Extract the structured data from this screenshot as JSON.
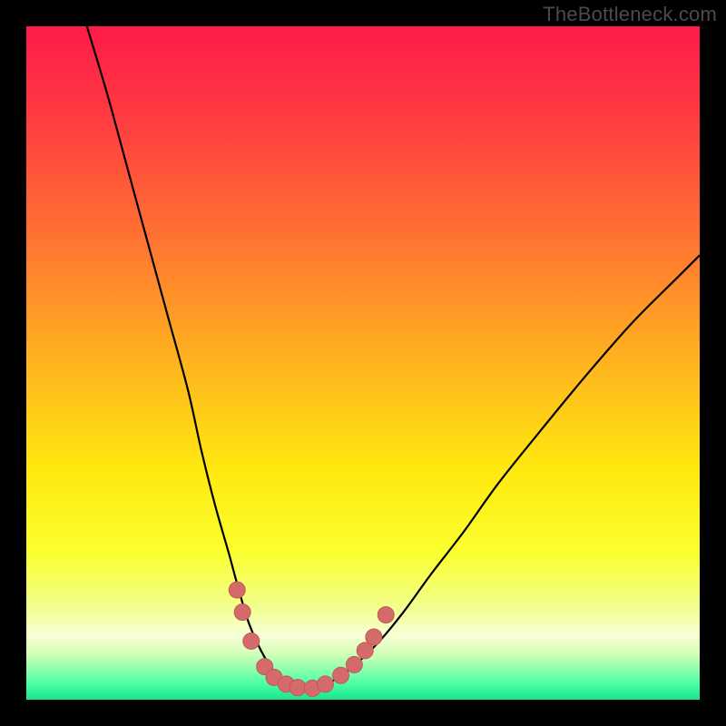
{
  "watermark": "TheBottleneck.com",
  "colors": {
    "frame_bg": "#000000",
    "curve_stroke": "#000000",
    "marker_fill": "#d46a6a",
    "marker_stroke": "#c15a5a"
  },
  "chart_data": {
    "type": "line",
    "title": "",
    "xlabel": "",
    "ylabel": "",
    "xlim": [
      0,
      100
    ],
    "ylim": [
      0,
      100
    ],
    "background_gradient": {
      "direction": "vertical",
      "stops": [
        {
          "offset": 0.0,
          "color": "#ff1a4a"
        },
        {
          "offset": 0.12,
          "color": "#ff3742"
        },
        {
          "offset": 0.3,
          "color": "#ff6e33"
        },
        {
          "offset": 0.5,
          "color": "#ffb41f"
        },
        {
          "offset": 0.66,
          "color": "#ffe90f"
        },
        {
          "offset": 0.78,
          "color": "#fbff2e"
        },
        {
          "offset": 0.86,
          "color": "#f2ff8a"
        },
        {
          "offset": 0.905,
          "color": "#f7ffd7"
        },
        {
          "offset": 0.93,
          "color": "#d6ffb8"
        },
        {
          "offset": 0.955,
          "color": "#8fffae"
        },
        {
          "offset": 0.975,
          "color": "#4dffa5"
        },
        {
          "offset": 1.0,
          "color": "#18e68f"
        }
      ]
    },
    "series": [
      {
        "name": "bottleneck-curve",
        "x": [
          9,
          12,
          15,
          18,
          21,
          24,
          26,
          28,
          30,
          31.5,
          33,
          34.5,
          36,
          37.5,
          39,
          41,
          43,
          45,
          48,
          52,
          56,
          60,
          65,
          70,
          76,
          83,
          90,
          97,
          100
        ],
        "y": [
          100,
          90,
          79,
          68,
          57,
          46,
          37,
          29,
          22,
          16.5,
          11.5,
          8,
          5.3,
          3.4,
          2.3,
          1.6,
          1.6,
          2.5,
          4.5,
          8.2,
          13,
          18.5,
          25,
          32,
          39.5,
          48,
          56,
          63,
          66
        ]
      }
    ],
    "markers": {
      "name": "highlight-points",
      "points": [
        {
          "x": 31.3,
          "y": 16.3
        },
        {
          "x": 32.1,
          "y": 13.0
        },
        {
          "x": 33.4,
          "y": 8.7
        },
        {
          "x": 35.4,
          "y": 4.9
        },
        {
          "x": 36.8,
          "y": 3.3
        },
        {
          "x": 38.6,
          "y": 2.3
        },
        {
          "x": 40.3,
          "y": 1.8
        },
        {
          "x": 42.5,
          "y": 1.7
        },
        {
          "x": 44.4,
          "y": 2.3
        },
        {
          "x": 46.7,
          "y": 3.6
        },
        {
          "x": 48.7,
          "y": 5.2
        },
        {
          "x": 50.3,
          "y": 7.3
        },
        {
          "x": 51.6,
          "y": 9.3
        },
        {
          "x": 53.4,
          "y": 12.6
        }
      ],
      "radius": 9
    }
  }
}
